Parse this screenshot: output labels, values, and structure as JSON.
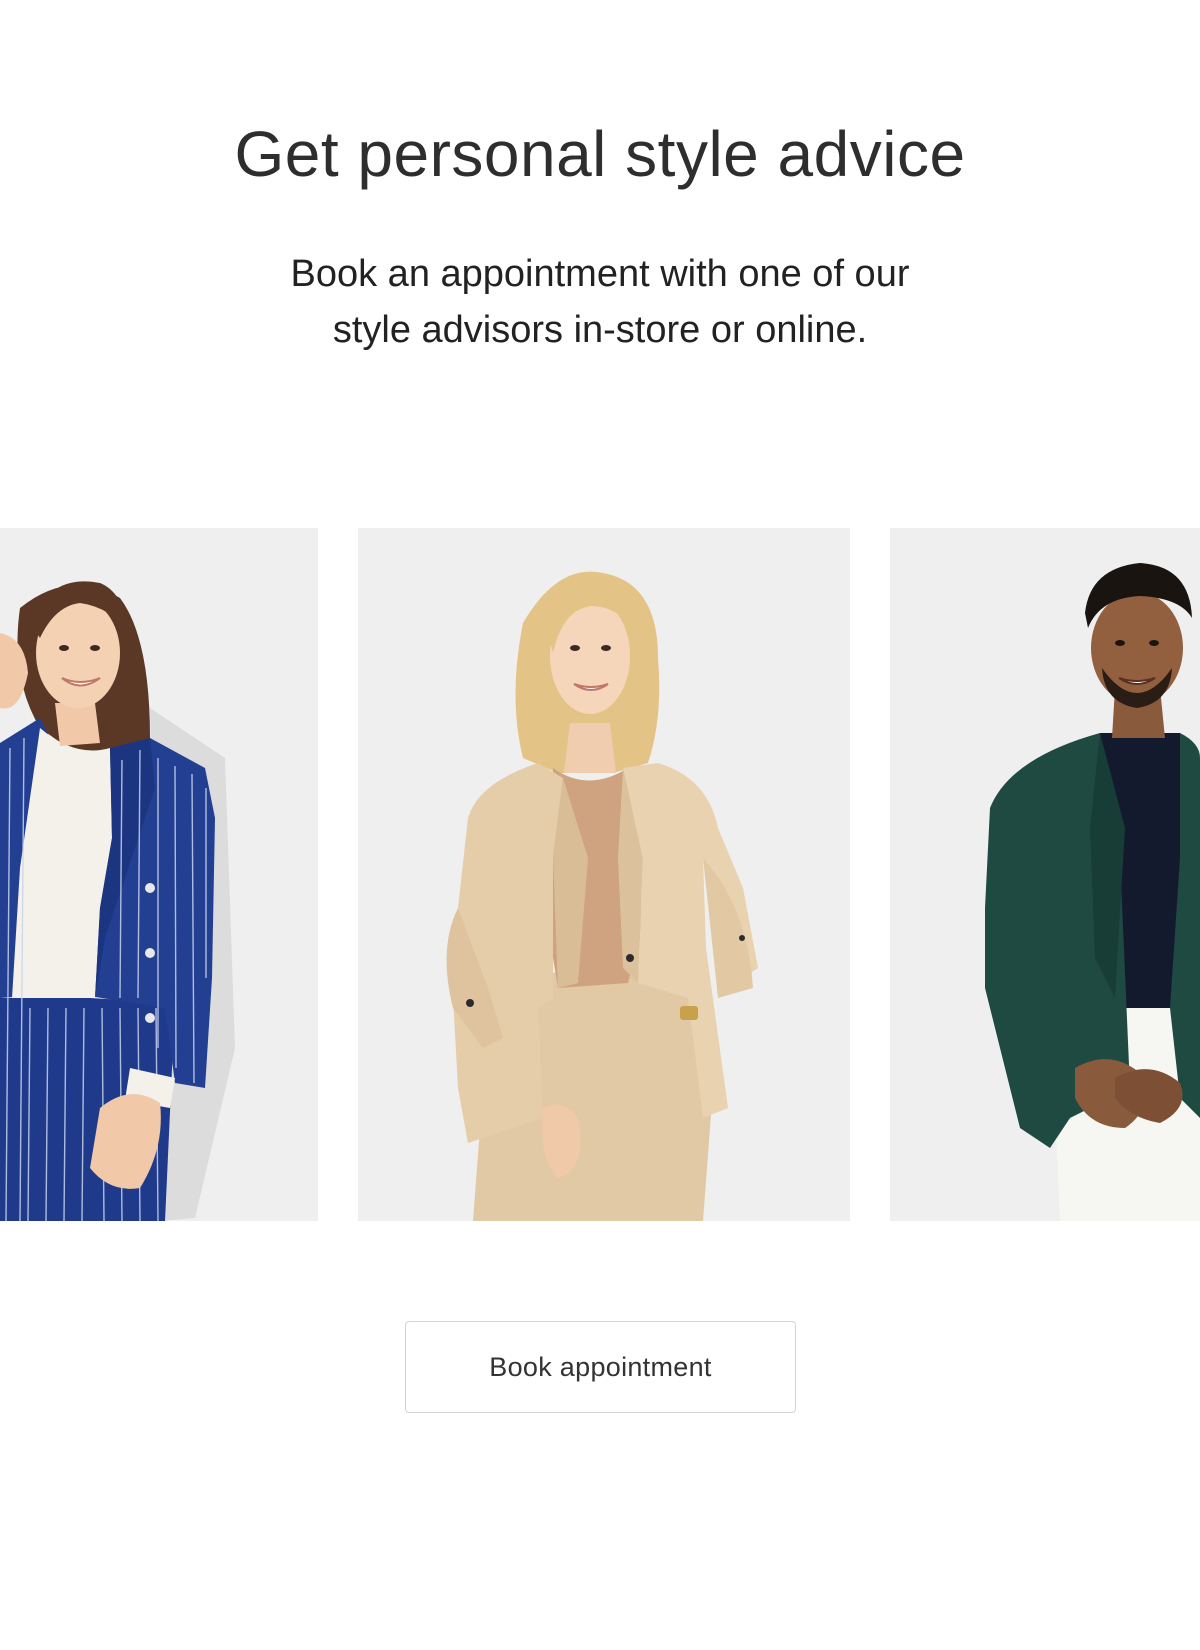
{
  "hero": {
    "title": "Get personal style advice",
    "subtitle_line1": "Book an appointment with one of our",
    "subtitle_line2": "style advisors in-store or online."
  },
  "carousel": {
    "items": [
      {
        "advisor": "advisor-navy-pinstripe-suit"
      },
      {
        "advisor": "advisor-camel-suit"
      },
      {
        "advisor": "advisor-green-blazer"
      }
    ]
  },
  "cta": {
    "label": "Book appointment"
  },
  "colors": {
    "card_background": "#efefef",
    "button_border": "#d4d4d4",
    "text": "#2e2e2e"
  }
}
